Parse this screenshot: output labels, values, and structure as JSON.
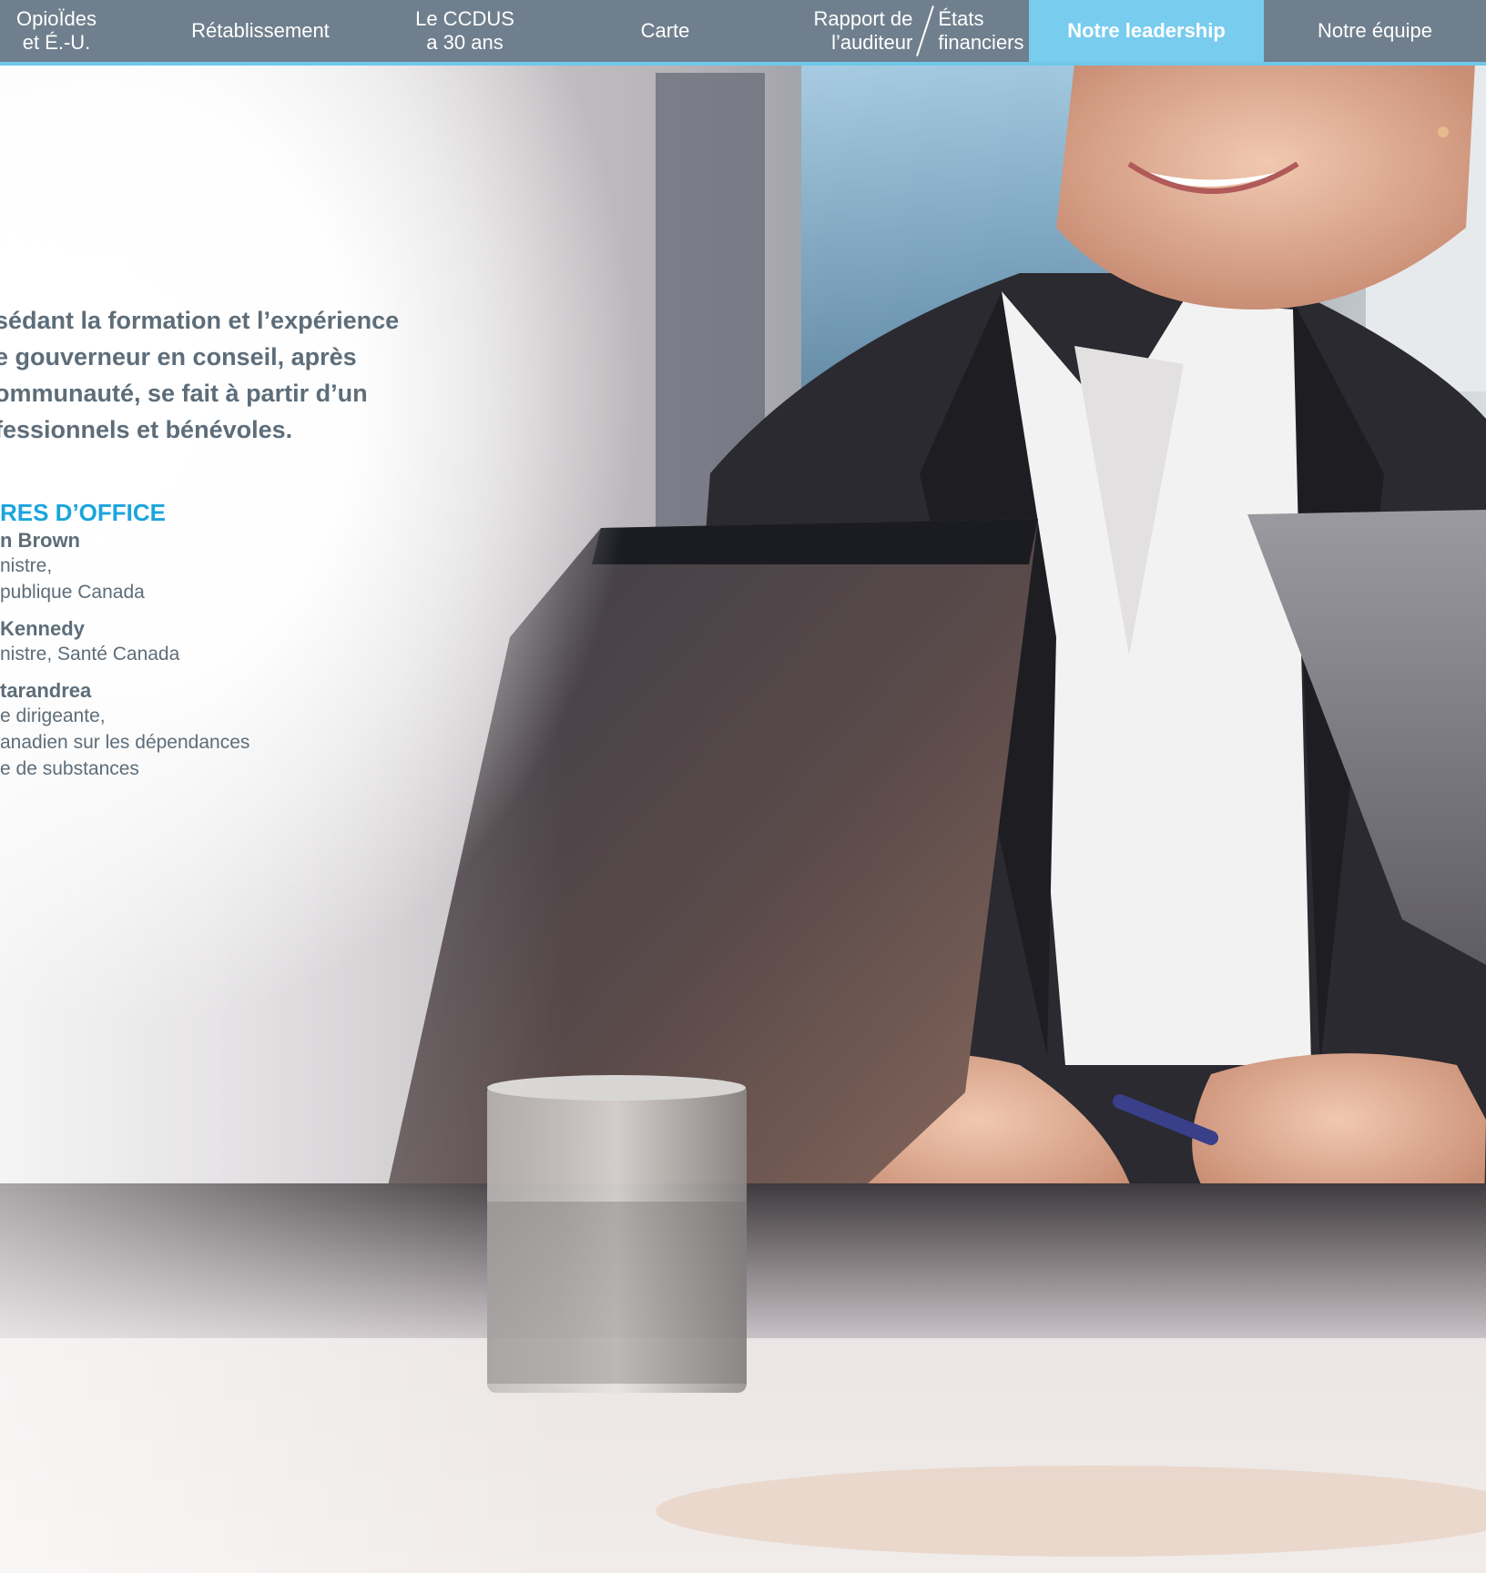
{
  "nav": {
    "items": [
      {
        "line1": "OpioÏdes",
        "line2": "et É.-U."
      },
      {
        "label": "Rétablissement"
      },
      {
        "line1": "Le CCDUS",
        "line2": "a 30 ans"
      },
      {
        "label": "Carte"
      },
      {
        "left1": "Rapport de",
        "left2": "l’auditeur",
        "right1": "États",
        "right2": "financiers"
      },
      {
        "label": "Notre leadership"
      },
      {
        "label": "Notre équipe"
      }
    ]
  },
  "intro": {
    "lines": [
      "sédant la formation et l’expérience",
      "e gouverneur en conseil, après",
      "ommunauté, se fait à partir d’un",
      "fessionnels et bénévoles."
    ]
  },
  "office": {
    "title": "RES D’OFFICE",
    "members": [
      {
        "name": "n Brown",
        "role": [
          "nistre,",
          " publique Canada"
        ]
      },
      {
        "name": "Kennedy",
        "role": [
          "nistre, Santé Canada"
        ]
      },
      {
        "name": "tarandrea",
        "role": [
          "e dirigeante,",
          "anadien sur les dépendances",
          "e de substances"
        ]
      }
    ]
  },
  "colors": {
    "nav_bg": "#6f7f8d",
    "nav_active": "#78ccee",
    "accent": "#1aa5dc",
    "text": "#5d6d79"
  }
}
